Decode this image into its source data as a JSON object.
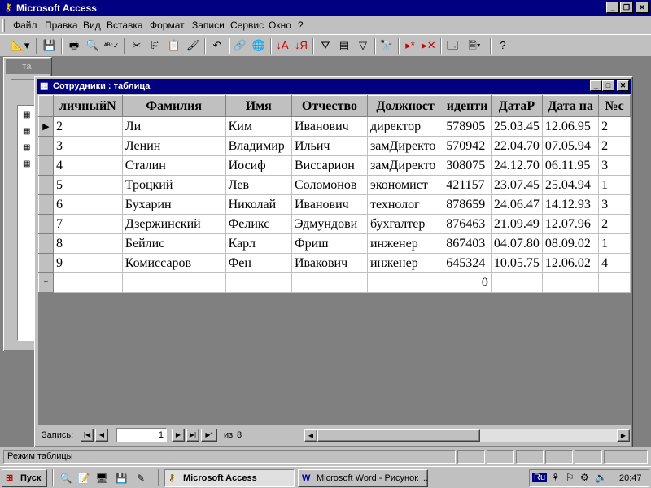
{
  "app_title": "Microsoft Access",
  "menu": [
    "Файл",
    "Правка",
    "Вид",
    "Вставка",
    "Формат",
    "Записи",
    "Сервис",
    "Окно",
    "?"
  ],
  "toolbar_icons": [
    "view-icon",
    "save-icon",
    "print-icon",
    "print-preview-icon",
    "spelling-icon",
    "cut-icon",
    "copy-icon",
    "paste-icon",
    "format-painter-icon",
    "undo-icon",
    "hyperlink-icon",
    "web-icon",
    "sort-ascending-icon",
    "sort-descending-icon",
    "filter-by-selection-icon",
    "filter-by-form-icon",
    "apply-filter-icon",
    "find-icon",
    "new-record-icon",
    "delete-record-icon",
    "database-window-icon",
    "new-object-icon",
    "help-icon"
  ],
  "db_window": {
    "title": "та"
  },
  "table_window": {
    "title": "Сотрудники : таблица"
  },
  "columns": [
    "личныйN",
    "Фамилия",
    "Имя",
    "Отчество",
    "Должност",
    "иденти",
    "ДатаР",
    "Дата на",
    "№с"
  ],
  "rows": [
    [
      "2",
      "Ли",
      "Ким",
      "Иванович",
      "директор",
      "578905",
      "25.03.45",
      "12.06.95",
      "2"
    ],
    [
      "3",
      "Ленин",
      "Владимир",
      "Ильич",
      "замДиректо",
      "570942",
      "22.04.70",
      "07.05.94",
      "2"
    ],
    [
      "4",
      "Сталин",
      "Иосиф",
      "Виссарион",
      "замДиректо",
      "308075",
      "24.12.70",
      "06.11.95",
      "3"
    ],
    [
      "5",
      "Троцкий",
      "Лев",
      "Соломонов",
      "экономист",
      "421157",
      "23.07.45",
      "25.04.94",
      "1"
    ],
    [
      "6",
      "Бухарин",
      "Николай",
      "Иванович",
      "технолог",
      "878659",
      "24.06.47",
      "14.12.93",
      "3"
    ],
    [
      "7",
      "Дзержинский",
      "Феликс",
      "Эдмундови",
      "бухгалтер",
      "876463",
      "21.09.49",
      "12.07.96",
      "2"
    ],
    [
      "8",
      "Бейлис",
      "Карл",
      "Фриш",
      "инженер",
      "867403",
      "04.07.80",
      "08.09.02",
      "1"
    ],
    [
      "9",
      "Комиссаров",
      "Фен",
      "Ивакович",
      "инженер",
      "645324",
      "10.05.75",
      "12.06.02",
      "4"
    ]
  ],
  "new_row": {
    "marker": "*",
    "id_value": "0"
  },
  "current_row_marker": "▶",
  "navigation": {
    "label": "Запись:",
    "current": "1",
    "of_label": "из",
    "total": "8"
  },
  "status_text": "Режим таблицы",
  "taskbar": {
    "start_label": "Пуск",
    "tasks": [
      "Microsoft Access",
      "Microsoft Word - Рисунок ..."
    ],
    "language": "Ru",
    "clock": "20:47"
  }
}
